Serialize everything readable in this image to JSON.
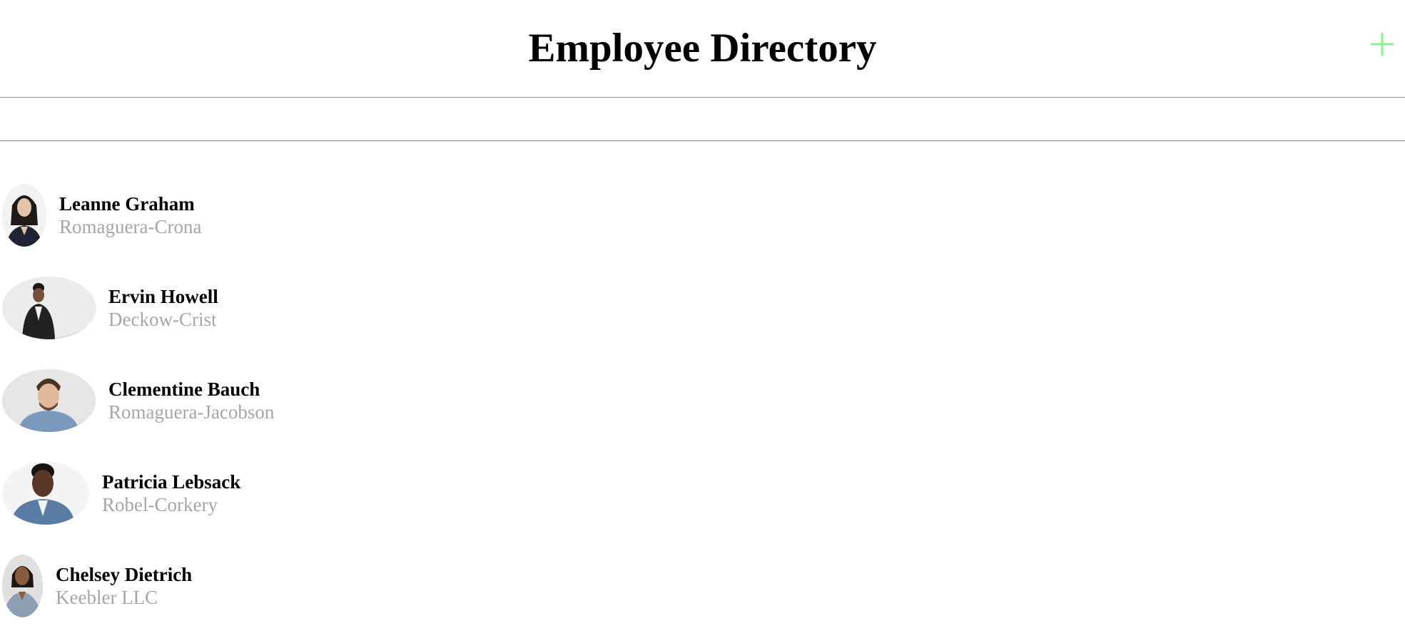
{
  "header": {
    "title": "Employee Directory",
    "add_icon": "plus-icon",
    "add_icon_color": "#90ee90"
  },
  "search": {
    "value": "",
    "placeholder": ""
  },
  "employees": [
    {
      "name": "Leanne Graham",
      "company": "Romaguera-Crona",
      "avatar": "person-photo"
    },
    {
      "name": "Ervin Howell",
      "company": "Deckow-Crist",
      "avatar": "person-photo"
    },
    {
      "name": "Clementine Bauch",
      "company": "Romaguera-Jacobson",
      "avatar": "person-photo"
    },
    {
      "name": "Patricia Lebsack",
      "company": "Robel-Corkery",
      "avatar": "person-photo"
    },
    {
      "name": "Chelsey Dietrich",
      "company": "Keebler LLC",
      "avatar": "person-photo"
    }
  ],
  "colors": {
    "name_text": "#000000",
    "company_text": "#a6a6a6",
    "divider": "#8a8a8a"
  }
}
